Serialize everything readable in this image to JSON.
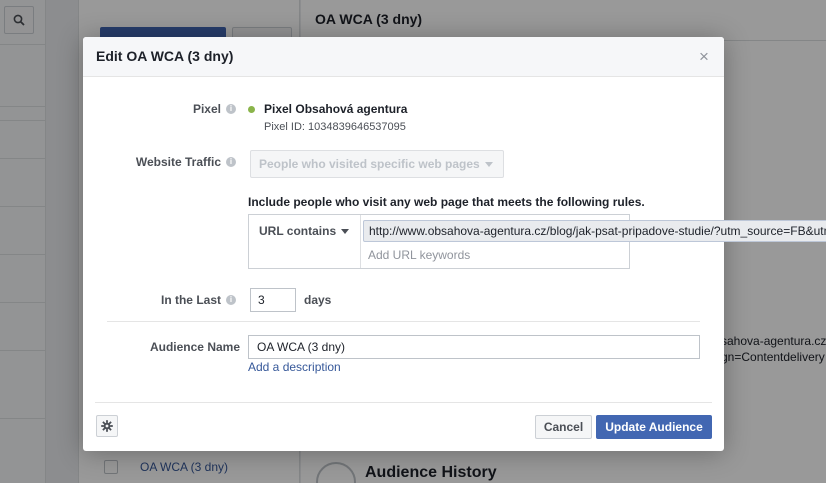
{
  "background": {
    "list_item_label": "OA WCA (3 dny)",
    "detail_title": "OA WCA (3 dny)",
    "detail_url_line1": "sahova-agentura.cz",
    "detail_url_line2": "gn=Contentdelivery",
    "history_title": "Audience History"
  },
  "dialog": {
    "title": "Edit OA WCA (3 dny)",
    "close_glyph": "×",
    "pixel": {
      "label": "Pixel",
      "name": "Pixel Obsahová agentura",
      "id_text": "Pixel ID: 1034839646537095",
      "status_color": "#8ab44a"
    },
    "website_traffic": {
      "label": "Website Traffic",
      "selected": "People who visited specific web pages"
    },
    "rules": {
      "title": "Include people who visit any web page that meets the following rules.",
      "type": "URL contains",
      "url_value": "http://www.obsahova-agentura.cz/blog/jak-psat-pripadove-studie/?utm_source=FB&utm",
      "keyword_placeholder": "Add URL keywords"
    },
    "in_the_last": {
      "label": "In the Last",
      "value": "3",
      "unit": "days"
    },
    "audience_name": {
      "label": "Audience Name",
      "value": "OA WCA (3 dny)",
      "add_description": "Add a description"
    },
    "footer": {
      "cancel_label": "Cancel",
      "update_label": "Update Audience"
    },
    "accent_color": "#4267b2"
  }
}
